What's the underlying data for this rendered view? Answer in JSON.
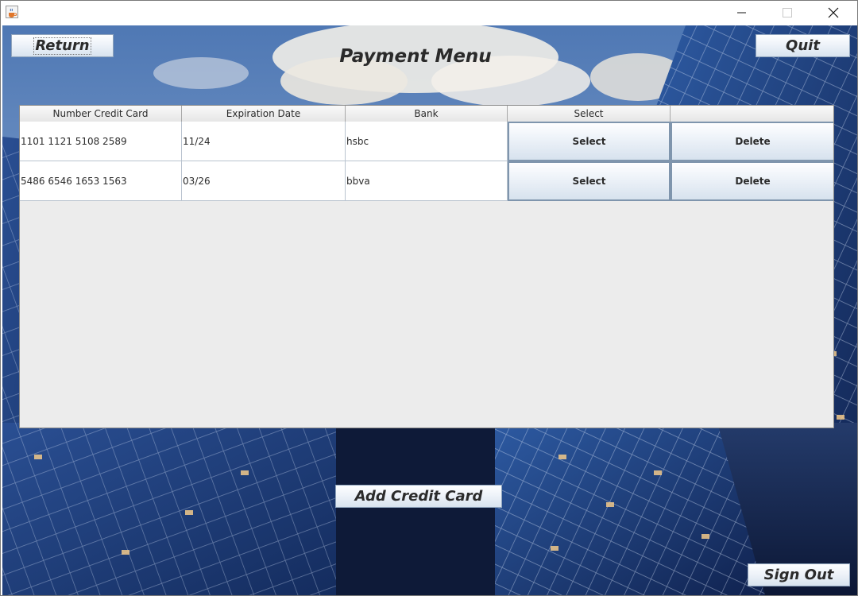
{
  "window": {
    "icon": "java-cup-icon",
    "controls": [
      "minimize-icon",
      "maximize-icon",
      "close-icon"
    ]
  },
  "header": {
    "title": "Payment Menu",
    "return_label": "Return",
    "quit_label": "Quit"
  },
  "table": {
    "columns": [
      "Number Credit Card",
      "Expiration Date",
      "Bank",
      "Select",
      ""
    ],
    "rows": [
      {
        "number": "1101 1121 5108 2589",
        "expiration": "11/24",
        "bank": "hsbc",
        "select_label": "Select",
        "delete_label": "Delete"
      },
      {
        "number": "5486 6546 1653 1563",
        "expiration": "03/26",
        "bank": "bbva",
        "select_label": "Select",
        "delete_label": "Delete"
      }
    ]
  },
  "footer": {
    "add_label": "Add Credit Card",
    "signout_label": "Sign Out"
  },
  "colors": {
    "button_border": "#8fa4bd",
    "sky": "#6e8fbf",
    "buildings": "#1d3d7a"
  }
}
